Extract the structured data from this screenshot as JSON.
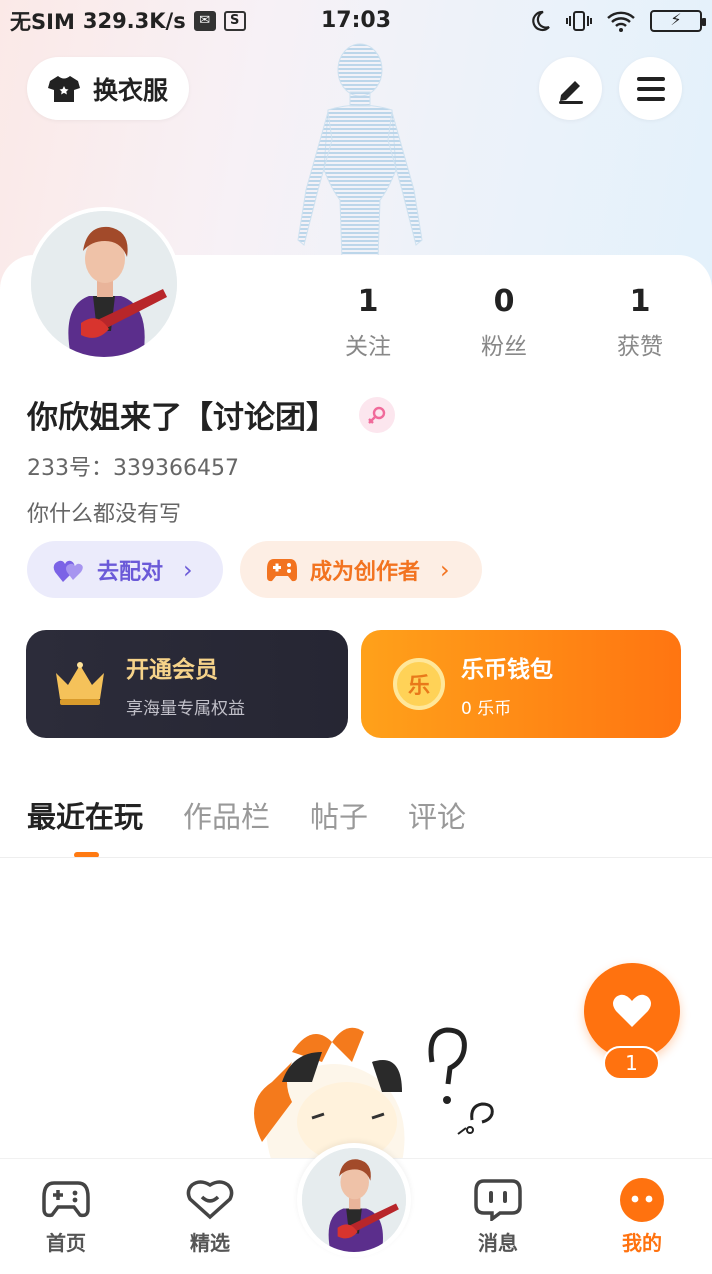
{
  "status_bar": {
    "carrier": "无SIM",
    "speed": "329.3K/s",
    "time": "17:03"
  },
  "header": {
    "change_clothes_label": "换衣服",
    "edit_icon": "pen-icon",
    "menu_icon": "hamburger-icon"
  },
  "stats": [
    {
      "value": "1",
      "label": "关注"
    },
    {
      "value": "0",
      "label": "粉丝"
    },
    {
      "value": "1",
      "label": "获赞"
    }
  ],
  "profile": {
    "username": "你欣姐来了【讨论团】",
    "uid": "233号：339366457",
    "bio": "你什么都没有写",
    "gender": "female"
  },
  "pills": {
    "match_label": "去配对",
    "creator_label": "成为创作者"
  },
  "promos": {
    "vip_title": "开通会员",
    "vip_sub": "享海量专属权益",
    "wallet_title": "乐币钱包",
    "wallet_sub": "0 乐币",
    "coin_glyph": "乐"
  },
  "tabs": [
    {
      "label": "最近在玩",
      "active": true
    },
    {
      "label": "作品栏",
      "active": false
    },
    {
      "label": "帖子",
      "active": false
    },
    {
      "label": "评论",
      "active": false
    }
  ],
  "like": {
    "count": "1"
  },
  "bottom_nav": [
    {
      "label": "首页"
    },
    {
      "label": "精选"
    },
    {
      "label": "消息"
    },
    {
      "label": "我的"
    }
  ],
  "colors": {
    "accent": "#ff720f",
    "purple": "#6b5ad8",
    "vip_gold": "#f6d38a"
  }
}
